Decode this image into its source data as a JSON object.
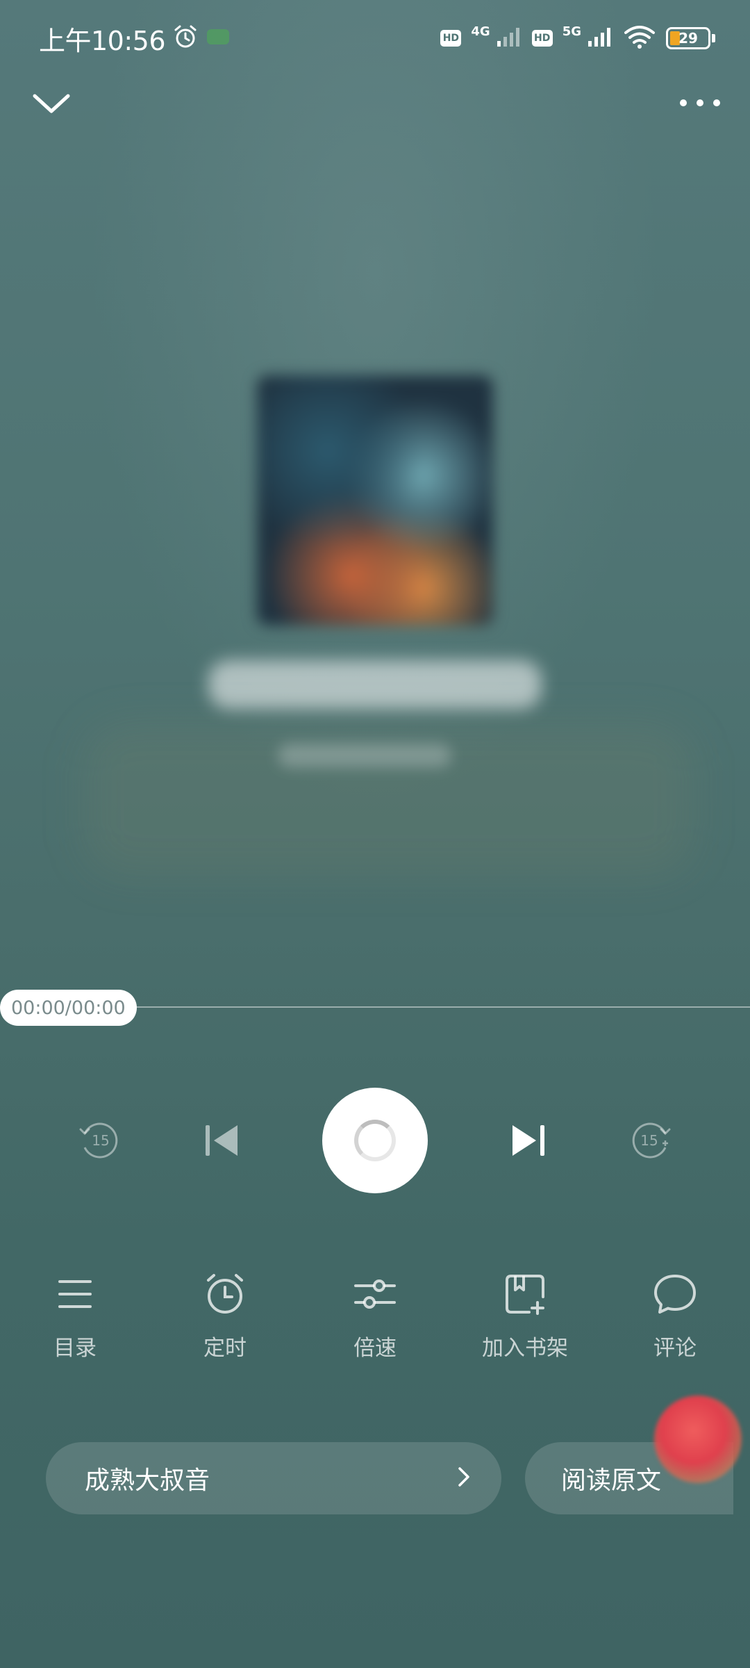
{
  "status_bar": {
    "time": "上午10:56",
    "hd1": "HD",
    "net1": "4G",
    "hd2": "HD",
    "net2": "5G",
    "battery": "29"
  },
  "player": {
    "time_display": "00:00/00:00",
    "progress": 0,
    "rewind_seconds": "15",
    "forward_seconds": "15"
  },
  "actions": [
    {
      "label": "目录",
      "icon": "list-icon"
    },
    {
      "label": "定时",
      "icon": "alarm-clock-icon"
    },
    {
      "label": "倍速",
      "icon": "sliders-icon"
    },
    {
      "label": "加入书架",
      "icon": "bookshelf-add-icon"
    },
    {
      "label": "评论",
      "icon": "comment-icon"
    }
  ],
  "voice_button": {
    "label": "成熟大叔音"
  },
  "read_original": {
    "label": "阅读原文"
  },
  "colors": {
    "background": "#4f7473",
    "accent_battery": "#f0a522",
    "float_ball": "#e0404d"
  }
}
